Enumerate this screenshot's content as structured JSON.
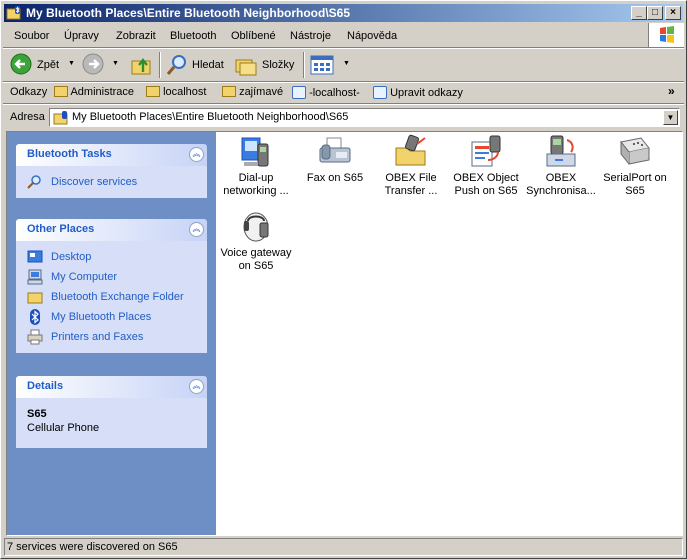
{
  "window": {
    "title": "My Bluetooth Places\\Entire Bluetooth Neighborhood\\S65",
    "minimize": "_",
    "maximize": "□",
    "close": "×"
  },
  "menubar": {
    "items": [
      "Soubor",
      "Úpravy",
      "Zobrazit",
      "Bluetooth",
      "Oblíbené",
      "Nástroje",
      "Nápověda"
    ]
  },
  "toolbar": {
    "back_label": "Zpět",
    "search_label": "Hledat",
    "folders_label": "Složky"
  },
  "links": {
    "label": "Odkazy",
    "items": [
      "Administrace",
      "localhost",
      "zajímavé",
      "-localhost-",
      "Upravit odkazy"
    ],
    "overflow": "»"
  },
  "address": {
    "label": "Adresa",
    "value": "My Bluetooth Places\\Entire Bluetooth Neighborhood\\S65"
  },
  "taskpane": {
    "bluetooth_tasks": {
      "title": "Bluetooth Tasks",
      "items": [
        "Discover services"
      ]
    },
    "other_places": {
      "title": "Other Places",
      "items": [
        "Desktop",
        "My Computer",
        "Bluetooth Exchange Folder",
        "My Bluetooth Places",
        "Printers and Faxes"
      ]
    },
    "details": {
      "title": "Details",
      "device_name": "S65",
      "device_type": "Cellular Phone"
    }
  },
  "services": [
    {
      "label": "Dial-up networking ...",
      "icon": "dialup-phone-icon"
    },
    {
      "label": "Fax on S65",
      "icon": "fax-icon"
    },
    {
      "label": "OBEX File Transfer ...",
      "icon": "obex-file-transfer-icon"
    },
    {
      "label": "OBEX Object Push on S65",
      "icon": "obex-object-push-icon"
    },
    {
      "label": "OBEX Synchronisa...",
      "icon": "obex-sync-icon"
    },
    {
      "label": "SerialPort on S65",
      "icon": "serial-port-icon"
    },
    {
      "label": "Voice gateway on S65",
      "icon": "voice-gateway-icon"
    }
  ],
  "status": {
    "text": "7 services were discovered on S65"
  },
  "colors": {
    "title_bar_start": "#0a246a",
    "title_bar_end": "#a6caf0",
    "task_pane": "#6e8fc6",
    "link_blue": "#215dc6"
  }
}
